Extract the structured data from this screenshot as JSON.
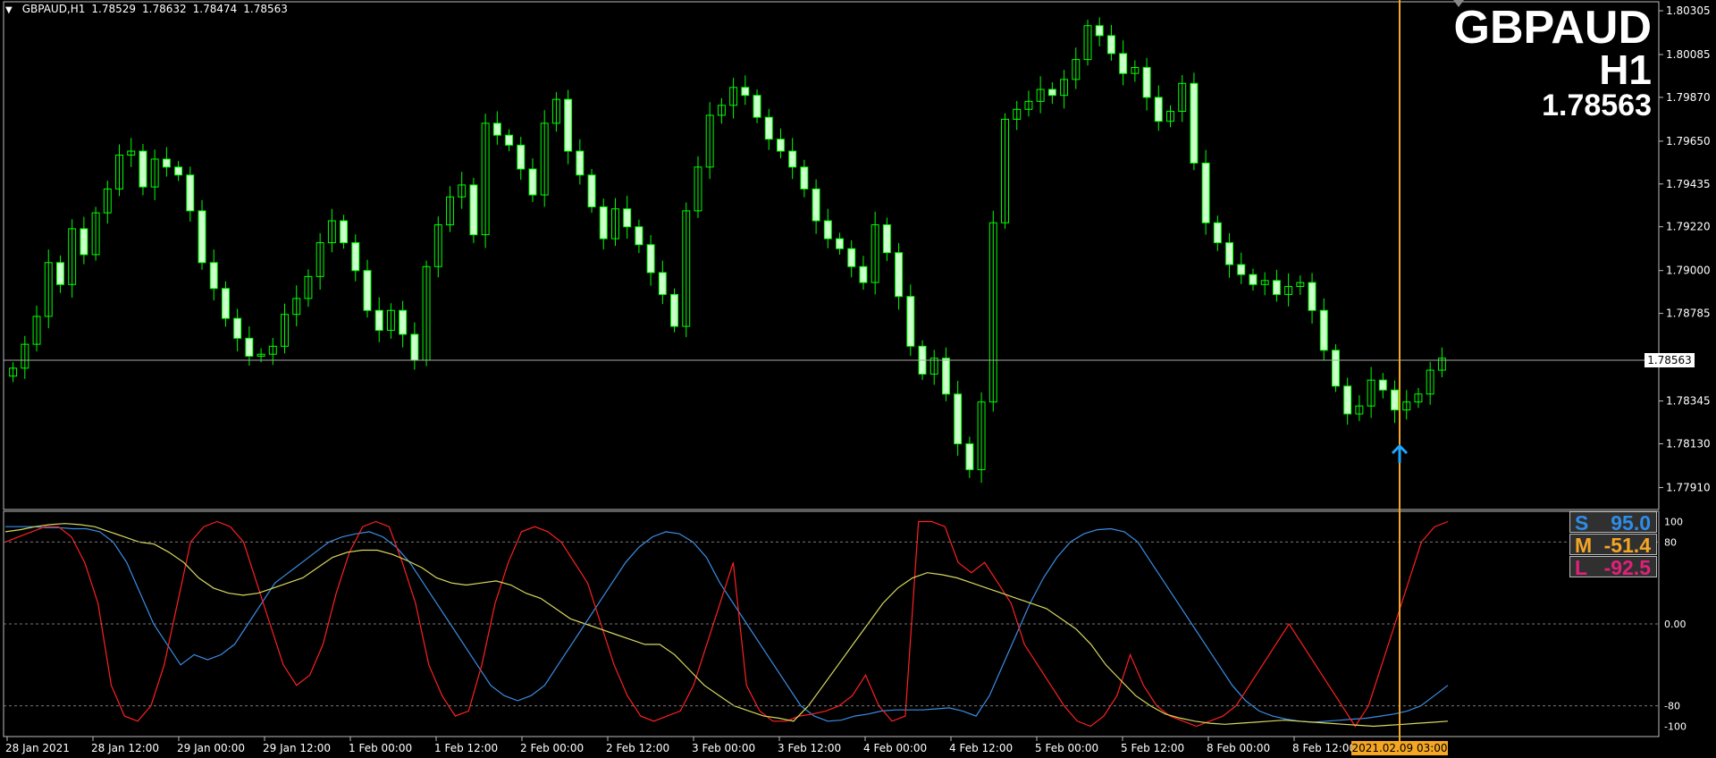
{
  "header": {
    "symbol_timeframe": "GBPAUD,H1",
    "open": "1.78529",
    "high": "1.78632",
    "low": "1.78474",
    "close": "1.78563"
  },
  "overlay": {
    "symbol": "GBPAUD",
    "timeframe": "H1",
    "price": "1.78563"
  },
  "price_axis": {
    "ticks": [
      "1.80305",
      "1.80085",
      "1.79870",
      "1.79650",
      "1.79435",
      "1.79220",
      "1.79000",
      "1.78785",
      "1.78563",
      "1.78345",
      "1.78130",
      "1.77910"
    ],
    "current": "1.78563"
  },
  "indicator_axis": {
    "ticks": [
      "100",
      "80",
      "0.00",
      "-80",
      "-100"
    ]
  },
  "indicator_boxes": [
    {
      "key": "S",
      "value": "95.0",
      "color": "#2e8de8"
    },
    {
      "key": "M",
      "value": "-51.4",
      "color": "#f5a623"
    },
    {
      "key": "L",
      "value": "-92.5",
      "color": "#e0207a"
    }
  ],
  "time_axis": {
    "labels": [
      "28 Jan 2021",
      "28 Jan 12:00",
      "29 Jan 00:00",
      "29 Jan 12:00",
      "1 Feb 00:00",
      "1 Feb 12:00",
      "2 Feb 00:00",
      "2 Feb 12:00",
      "3 Feb 00:00",
      "3 Feb 12:00",
      "4 Feb 00:00",
      "4 Feb 12:00",
      "5 Feb 00:00",
      "5 Feb 12:00",
      "8 Feb 00:00",
      "8 Feb 12:00"
    ],
    "cursor": "2021.02.09 03:00"
  },
  "colors": {
    "candle": "#00ff00",
    "bull_body": "#ccffcc",
    "red_line": "#ff2020",
    "blue_line": "#3a8ee6",
    "yellow_line": "#d8d860",
    "cursor_line": "#f5a623",
    "arrow": "#1ea7ff"
  },
  "chart_data": {
    "type": "candlestick",
    "price_ylim": [
      1.778,
      1.8035
    ],
    "closes": [
      1.7851,
      1.7863,
      1.7877,
      1.7904,
      1.7893,
      1.7921,
      1.7908,
      1.7929,
      1.7941,
      1.7958,
      1.796,
      1.7942,
      1.7956,
      1.7952,
      1.7948,
      1.793,
      1.7904,
      1.7891,
      1.7876,
      1.7866,
      1.7857,
      1.7858,
      1.7862,
      1.7878,
      1.7886,
      1.7897,
      1.7914,
      1.7925,
      1.7914,
      1.79,
      1.788,
      1.787,
      1.788,
      1.7868,
      1.7855,
      1.7902,
      1.7923,
      1.7937,
      1.7943,
      1.7918,
      1.7974,
      1.7968,
      1.7963,
      1.7951,
      1.7938,
      1.7974,
      1.7986,
      1.796,
      1.7948,
      1.7932,
      1.7916,
      1.7931,
      1.7922,
      1.7913,
      1.7899,
      1.7888,
      1.7872,
      1.793,
      1.7952,
      1.7978,
      1.7983,
      1.7992,
      1.7988,
      1.7977,
      1.7966,
      1.796,
      1.7952,
      1.7941,
      1.7925,
      1.7916,
      1.7911,
      1.7902,
      1.7894,
      1.7923,
      1.7909,
      1.7887,
      1.7862,
      1.7848,
      1.7856,
      1.7838,
      1.7813,
      1.78,
      1.7834,
      1.7924,
      1.7976,
      1.7981,
      1.7985,
      1.7991,
      1.7988,
      1.7996,
      1.8006,
      1.8023,
      1.8018,
      1.8009,
      1.7999,
      1.8002,
      1.7987,
      1.7975,
      1.798,
      1.7994,
      1.7954,
      1.7924,
      1.7914,
      1.7903,
      1.7898,
      1.7893,
      1.7895,
      1.7888,
      1.7892,
      1.7894,
      1.788,
      1.786,
      1.7842,
      1.7828,
      1.7832,
      1.7845,
      1.784,
      1.783,
      1.7834,
      1.7838,
      1.785,
      1.7856
    ],
    "indicator_ylim": [
      -110,
      110
    ],
    "series": [
      {
        "name": "S",
        "values": [
          95,
          95,
          95,
          94,
          94,
          93,
          93,
          90,
          80,
          60,
          30,
          0,
          -20,
          -40,
          -30,
          -35,
          -30,
          -20,
          0,
          20,
          40,
          50,
          60,
          70,
          80,
          85,
          88,
          90,
          85,
          75,
          60,
          40,
          20,
          0,
          -20,
          -40,
          -60,
          -70,
          -75,
          -70,
          -60,
          -40,
          -20,
          0,
          20,
          40,
          60,
          75,
          85,
          90,
          88,
          80,
          65,
          40,
          20,
          0,
          -20,
          -40,
          -60,
          -80,
          -90,
          -95,
          -94,
          -90,
          -88,
          -85,
          -84,
          -84,
          -84,
          -83,
          -82,
          -85,
          -90,
          -70,
          -40,
          -10,
          20,
          45,
          65,
          80,
          88,
          92,
          93,
          90,
          80,
          60,
          40,
          20,
          0,
          -20,
          -40,
          -60,
          -75,
          -85,
          -90,
          -93,
          -95,
          -96,
          -95,
          -94,
          -93,
          -92,
          -90,
          -88,
          -85,
          -80,
          -70,
          -60
        ]
      },
      {
        "name": "M",
        "values": [
          80,
          85,
          90,
          95,
          95,
          85,
          60,
          20,
          -60,
          -90,
          -95,
          -80,
          -40,
          20,
          80,
          95,
          100,
          95,
          80,
          40,
          0,
          -40,
          -60,
          -50,
          -20,
          30,
          70,
          95,
          100,
          95,
          60,
          20,
          -40,
          -70,
          -90,
          -85,
          -40,
          20,
          60,
          90,
          95,
          90,
          80,
          60,
          40,
          0,
          -40,
          -70,
          -90,
          -95,
          -90,
          -85,
          -60,
          -20,
          20,
          60,
          -60,
          -85,
          -95,
          -95,
          -90,
          -88,
          -85,
          -80,
          -70,
          -50,
          -80,
          -95,
          -90,
          100,
          100,
          95,
          60,
          50,
          60,
          40,
          20,
          -20,
          -40,
          -60,
          -80,
          -95,
          -100,
          -90,
          -70,
          -30,
          -60,
          -80,
          -90,
          -95,
          -100,
          -95,
          -90,
          -80,
          -60,
          -40,
          -20,
          0,
          -20,
          -40,
          -60,
          -80,
          -100,
          -80,
          -40,
          0,
          40,
          80,
          95,
          100
        ]
      },
      {
        "name": "L",
        "values": [
          90,
          92,
          95,
          97,
          98,
          97,
          95,
          90,
          85,
          80,
          78,
          70,
          60,
          45,
          35,
          30,
          28,
          30,
          35,
          40,
          45,
          55,
          65,
          70,
          72,
          72,
          68,
          62,
          55,
          45,
          40,
          38,
          40,
          42,
          38,
          30,
          25,
          15,
          5,
          0,
          -5,
          -10,
          -15,
          -20,
          -20,
          -30,
          -45,
          -60,
          -70,
          -80,
          -85,
          -90,
          -92,
          -95,
          -80,
          -60,
          -40,
          -20,
          0,
          20,
          35,
          45,
          50,
          48,
          45,
          40,
          35,
          30,
          25,
          20,
          15,
          5,
          -5,
          -20,
          -40,
          -55,
          -70,
          -80,
          -88,
          -92,
          -95,
          -97,
          -98,
          -97,
          -96,
          -95,
          -94,
          -95,
          -96,
          -97,
          -98,
          -99,
          -100,
          -99,
          -98,
          -97,
          -96,
          -95
        ]
      }
    ]
  }
}
